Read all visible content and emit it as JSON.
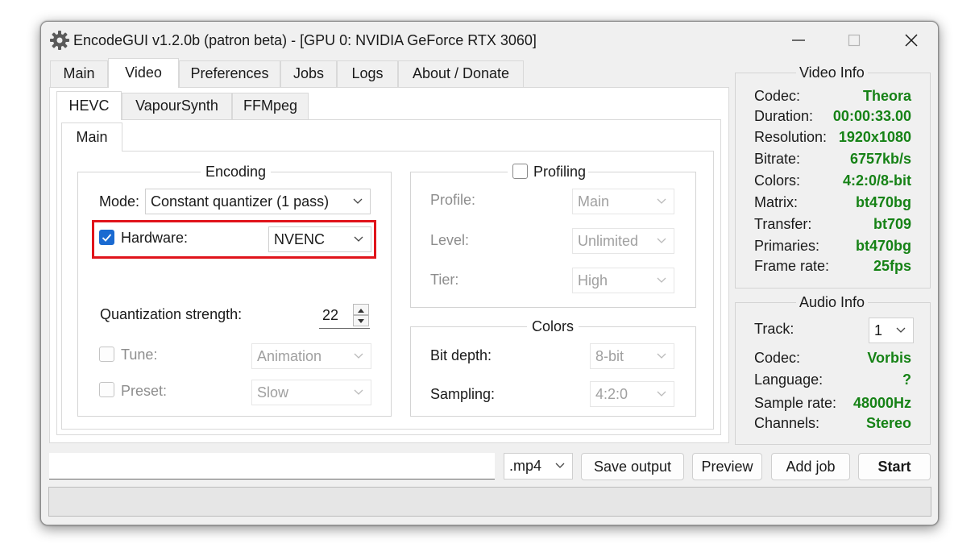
{
  "window": {
    "title": "EncodeGUI v1.2.0b (patron beta) - [GPU 0: NVIDIA GeForce RTX 3060]",
    "icon": "gear-icon",
    "controls": [
      "minimize-icon",
      "maximize-icon",
      "close-icon"
    ]
  },
  "main_tabs": [
    "Main",
    "Video",
    "Preferences",
    "Jobs",
    "Logs",
    "About / Donate"
  ],
  "active_main_tab": "Video",
  "sub_tabs": [
    "HEVC",
    "VapourSynth",
    "FFMpeg"
  ],
  "active_sub_tab": "HEVC",
  "inner_tabs": [
    "Main"
  ],
  "encoding": {
    "title": "Encoding",
    "mode_label": "Mode:",
    "mode_value": "Constant quantizer (1 pass)",
    "hardware_label": "Hardware:",
    "hardware_checked": true,
    "hardware_value": "NVENC",
    "qs_label": "Quantization strength:",
    "qs_value": "22",
    "tune_label": "Tune:",
    "tune_value": "Animation",
    "preset_label": "Preset:",
    "preset_value": "Slow"
  },
  "profiling": {
    "title": "Profiling",
    "checked": false,
    "profile_label": "Profile:",
    "profile_value": "Main",
    "level_label": "Level:",
    "level_value": "Unlimited",
    "tier_label": "Tier:",
    "tier_value": "High"
  },
  "colors": {
    "title": "Colors",
    "bit_depth_label": "Bit depth:",
    "bit_depth_value": "8-bit",
    "sampling_label": "Sampling:",
    "sampling_value": "4:2:0"
  },
  "video_info": {
    "title": "Video Info",
    "rows": [
      {
        "key": "Codec:",
        "value": "Theora"
      },
      {
        "key": "Duration:",
        "value": "00:00:33.00"
      },
      {
        "key": "Resolution:",
        "value": "1920x1080"
      },
      {
        "key": "Bitrate:",
        "value": "6757kb/s"
      },
      {
        "key": "Colors:",
        "value": "4:2:0/8-bit"
      },
      {
        "key": "Matrix:",
        "value": "bt470bg"
      },
      {
        "key": "Transfer:",
        "value": "bt709"
      },
      {
        "key": "Primaries:",
        "value": "bt470bg"
      },
      {
        "key": "Frame rate:",
        "value": "25fps"
      }
    ]
  },
  "audio_info": {
    "title": "Audio Info",
    "track_label": "Track:",
    "track_value": "1",
    "rows": [
      {
        "key": "Codec:",
        "value": "Vorbis"
      },
      {
        "key": "Language:",
        "value": "?"
      },
      {
        "key": "Sample rate:",
        "value": "48000Hz"
      },
      {
        "key": "Channels:",
        "value": "Stereo"
      }
    ]
  },
  "bottom": {
    "output_path": "",
    "container": ".mp4",
    "save_output": "Save output",
    "preview": "Preview",
    "add_job": "Add job",
    "start": "Start"
  },
  "colors_theme": {
    "accent": "#1a6ad1",
    "value_green": "#168216",
    "highlight_red": "#e0141b"
  }
}
